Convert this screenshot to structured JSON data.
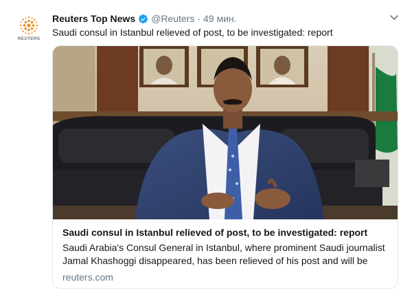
{
  "tweet": {
    "avatar_label": "REUTERS",
    "author_name": "Reuters Top News",
    "handle": "@Reuters",
    "separator": "·",
    "time": "49 мин.",
    "text": "Saudi consul in Istanbul relieved of post, to be investigated: report",
    "icons": {
      "verified": "verified-badge-icon",
      "menu": "chevron-down-icon"
    }
  },
  "card": {
    "title": "Saudi consul in Istanbul relieved of post, to be investigated: report",
    "description": "Saudi Arabia's Consul General in Istanbul, where prominent Saudi journalist Jamal Khashoggi disappeared, has been relieved of his post and will be",
    "domain": "reuters.com"
  },
  "colors": {
    "text": "#14171a",
    "secondary": "#657786",
    "verified": "#1da1f2",
    "border": "#e1e8ed",
    "reuters_orange": "#f08a24"
  }
}
